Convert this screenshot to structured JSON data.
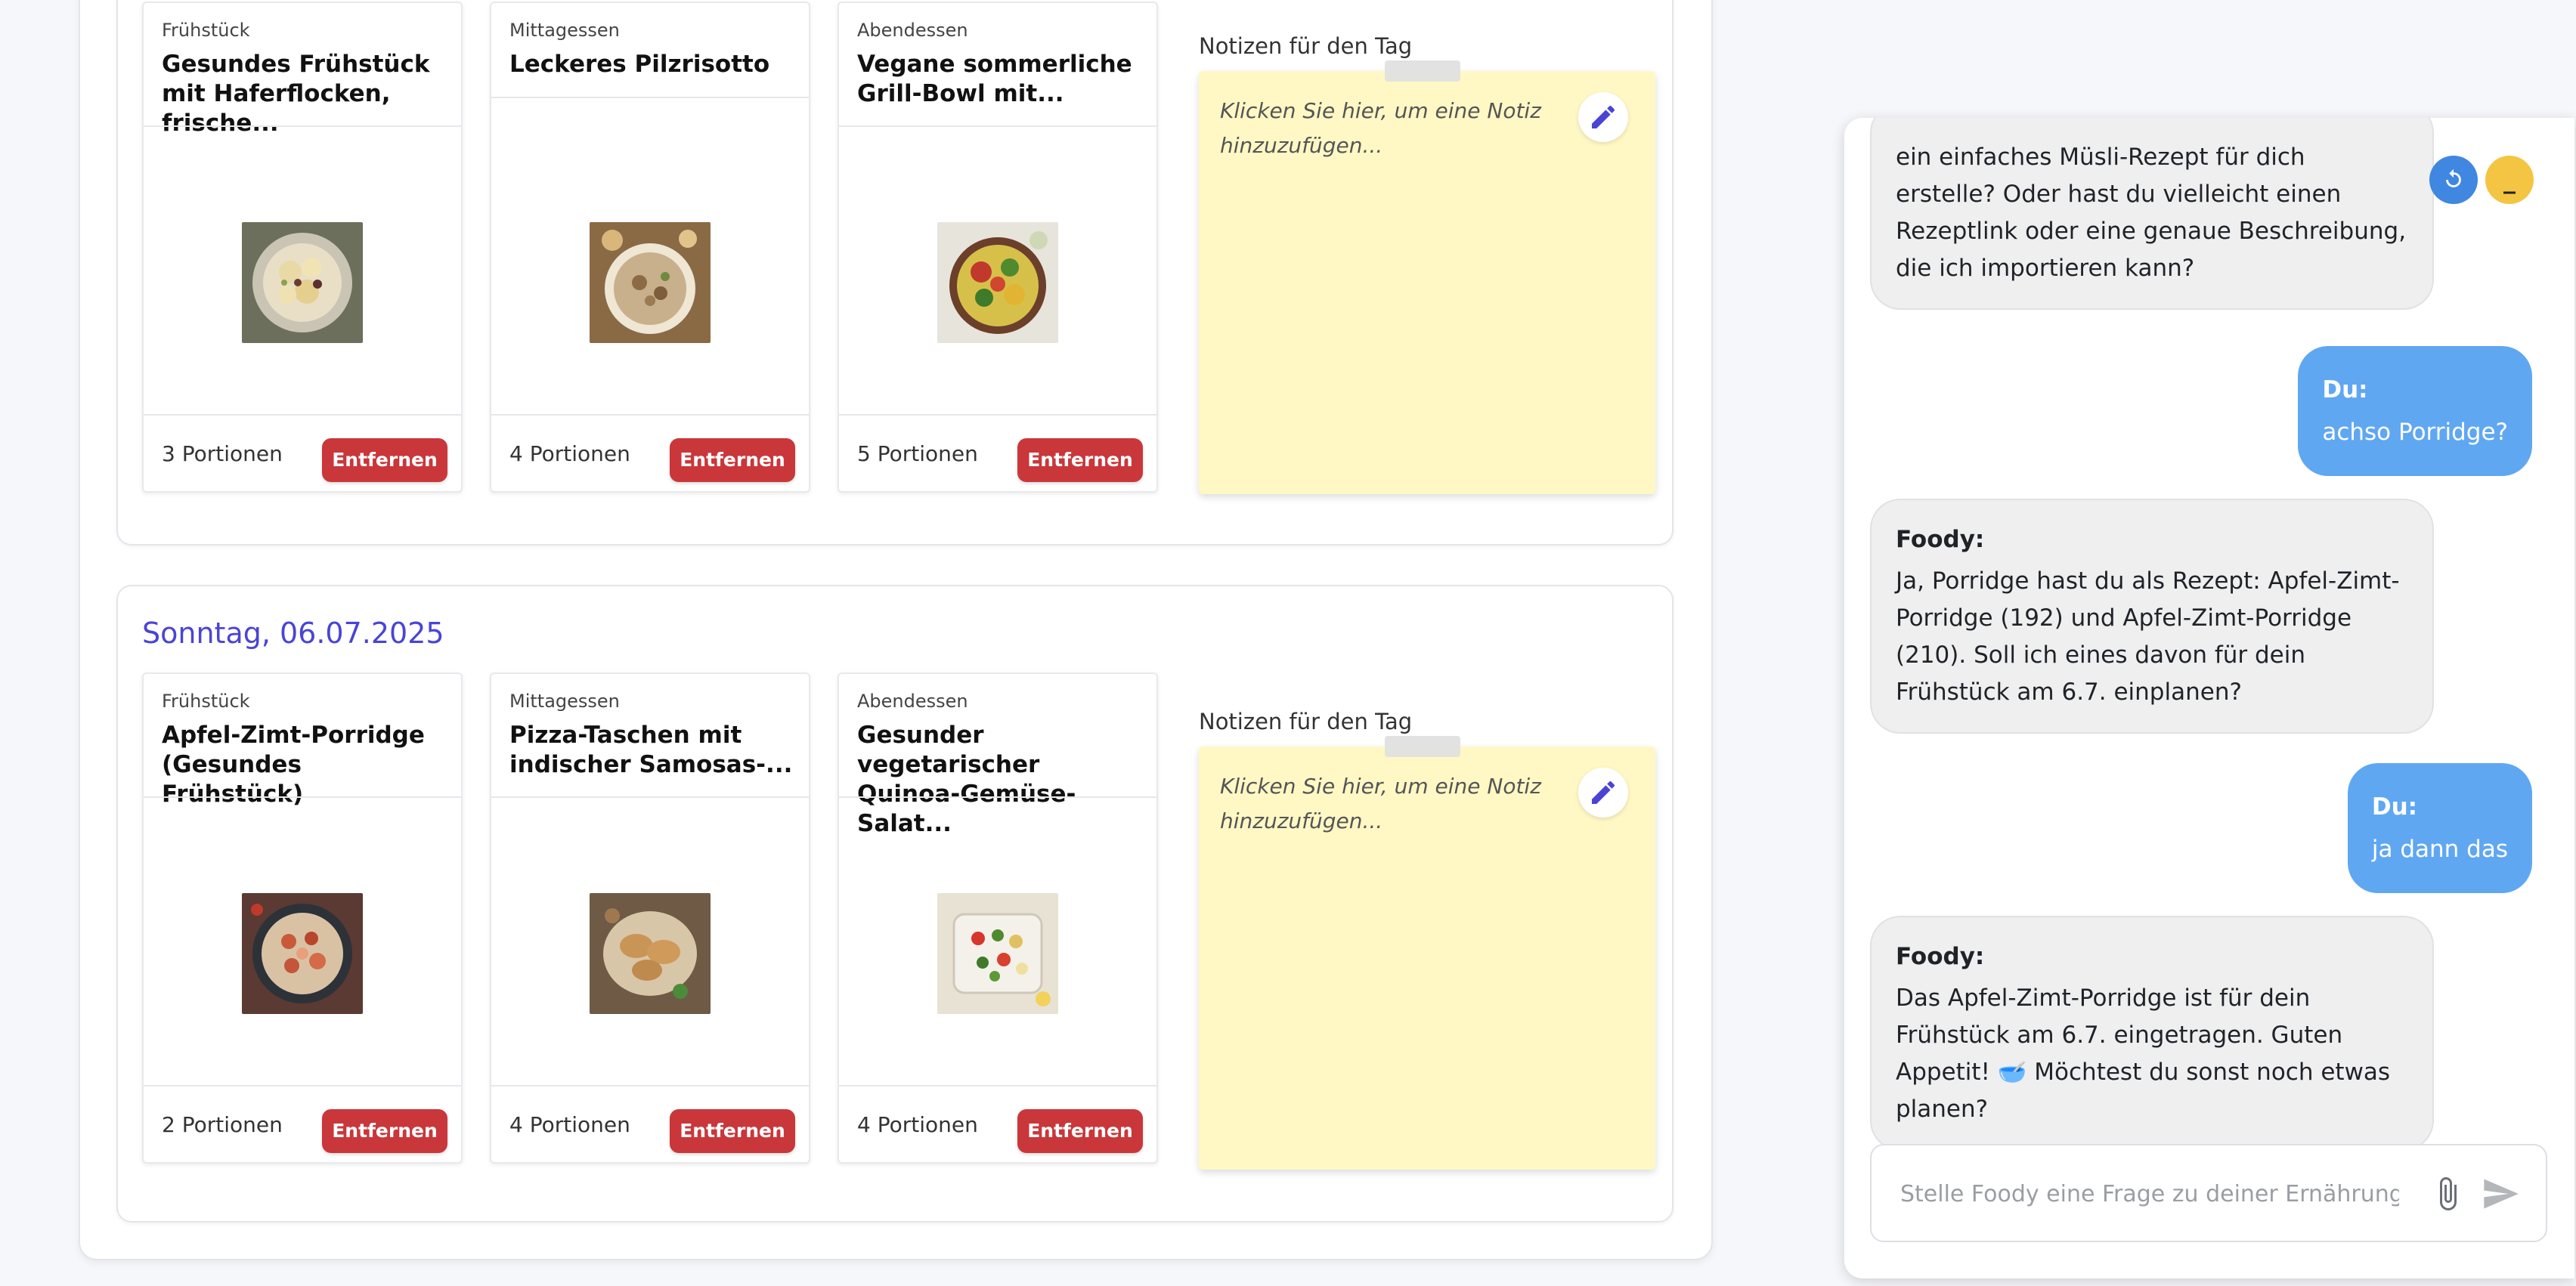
{
  "planner": {
    "days": [
      {
        "title": "",
        "meals": [
          {
            "type": "Frühstück",
            "title": "Gesundes Frühstück mit Haferflocken, frische...",
            "portions": "3 Portionen",
            "remove_label": "Entfernen",
            "image": "apple-oat-bowl"
          },
          {
            "type": "Mittagessen",
            "title": "Leckeres Pilzrisotto",
            "portions": "4 Portionen",
            "remove_label": "Entfernen",
            "image": "mushroom-risotto"
          },
          {
            "type": "Abendessen",
            "title": "Vegane sommerliche Grill-Bowl mit...",
            "portions": "5 Portionen",
            "remove_label": "Entfernen",
            "image": "vegan-grill-bowl"
          }
        ],
        "notes_label": "Notizen für den Tag",
        "notes_placeholder": "Klicken Sie hier, um eine Notiz hinzuzufügen..."
      },
      {
        "title": "Sonntag, 06.07.2025",
        "meals": [
          {
            "type": "Frühstück",
            "title": "Apfel-Zimt-Porridge (Gesundes Frühstück)",
            "portions": "2 Portionen",
            "remove_label": "Entfernen",
            "image": "apple-cinnamon-porridge"
          },
          {
            "type": "Mittagessen",
            "title": "Pizza-Taschen mit indischer Samosas-...",
            "portions": "4 Portionen",
            "remove_label": "Entfernen",
            "image": "pizza-pockets"
          },
          {
            "type": "Abendessen",
            "title": "Gesunder vegetarischer Quinoa-Gemüse-Salat...",
            "portions": "4 Portionen",
            "remove_label": "Entfernen",
            "image": "quinoa-salad"
          }
        ],
        "notes_label": "Notizen für den Tag",
        "notes_placeholder": "Klicken Sie hier, um eine Notiz hinzuzufügen..."
      }
    ]
  },
  "chat": {
    "messages": [
      {
        "role": "bot",
        "sender": "",
        "text": "ein einfaches Müsli-Rezept für dich erstelle? Oder hast du vielleicht einen Rezeptlink oder eine genaue Beschreibung, die ich importieren kann?"
      },
      {
        "role": "user",
        "sender": "Du:",
        "text": "achso Porridge?"
      },
      {
        "role": "bot",
        "sender": "Foody:",
        "text": "Ja, Porridge hast du als Rezept: Apfel-Zimt-Porridge (192) und Apfel-Zimt-Porridge (210). Soll ich eines davon für dein Frühstück am 6.7. einplanen?"
      },
      {
        "role": "user",
        "sender": "Du:",
        "text": "ja dann das"
      },
      {
        "role": "bot",
        "sender": "Foody:",
        "text": "Das Apfel-Zimt-Porridge ist für dein Frühstück am 6.7. eingetragen. Guten Appetit! 🥣 Möchtest du sonst noch etwas planen?"
      }
    ],
    "controls": {
      "reset_icon": "refresh-icon",
      "minimize_label": "_"
    },
    "input": {
      "placeholder": "Stelle Foody eine Frage zu deiner Ernährung...",
      "value": ""
    },
    "icons": {
      "attach": "paperclip-icon",
      "send": "send-icon"
    }
  },
  "colors": {
    "accent": "#4a44d6",
    "remove_button": "#c9373b",
    "sticky_note": "#fff8c5",
    "user_bubble": "#60a7f2",
    "bot_bubble": "#efefef",
    "reset_button": "#3f87e0",
    "minimize_button": "#f4c542"
  }
}
